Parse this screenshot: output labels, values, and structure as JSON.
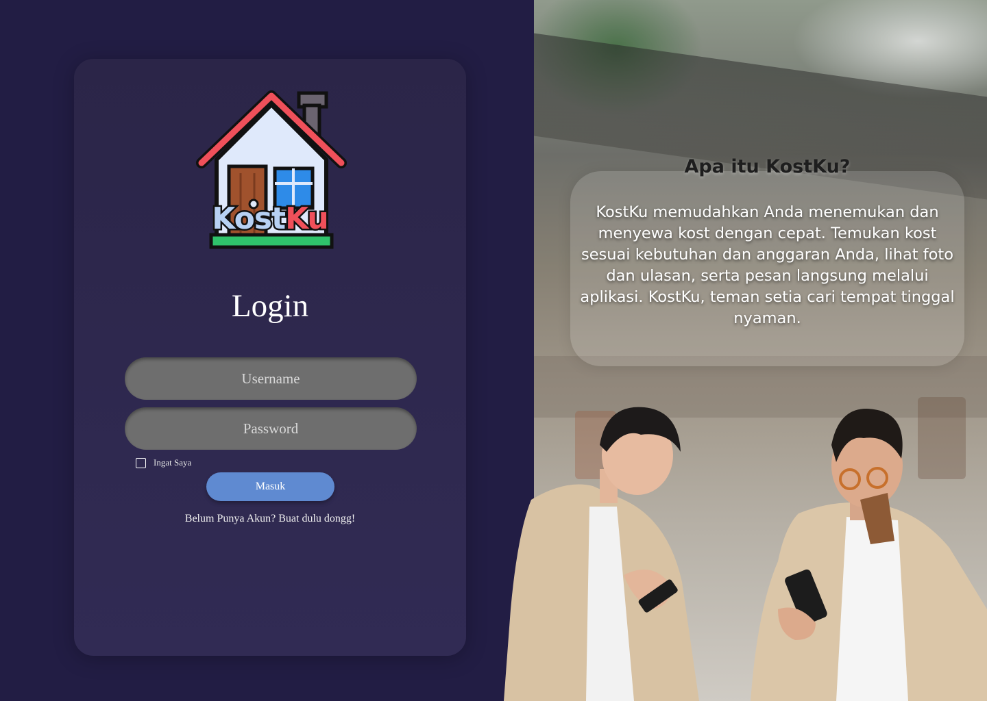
{
  "brand": {
    "logo_text": "KostKu"
  },
  "login": {
    "title": "Login",
    "username_placeholder": "Username",
    "password_placeholder": "Password",
    "remember_label": "Ingat Saya",
    "submit_label": "Masuk",
    "register_text": "Belum Punya Akun? Buat dulu dongg!"
  },
  "info": {
    "heading": "Apa itu KostKu?",
    "body": "KostKu memudahkan Anda menemukan dan menyewa kost dengan cepat. Temukan kost sesuai kebutuhan dan anggaran Anda, lihat foto dan ulasan, serta pesan langsung melalui aplikasi. KostKu, teman setia cari tempat tinggal nyaman."
  },
  "colors": {
    "background": "#221d44",
    "card": "#2e2850",
    "input": "#6e6e6e",
    "button": "#5f8ad1",
    "logo_roof": "#f0505a",
    "logo_door": "#a0522d",
    "logo_window": "#2e8be8",
    "logo_ground": "#2fc36b"
  }
}
